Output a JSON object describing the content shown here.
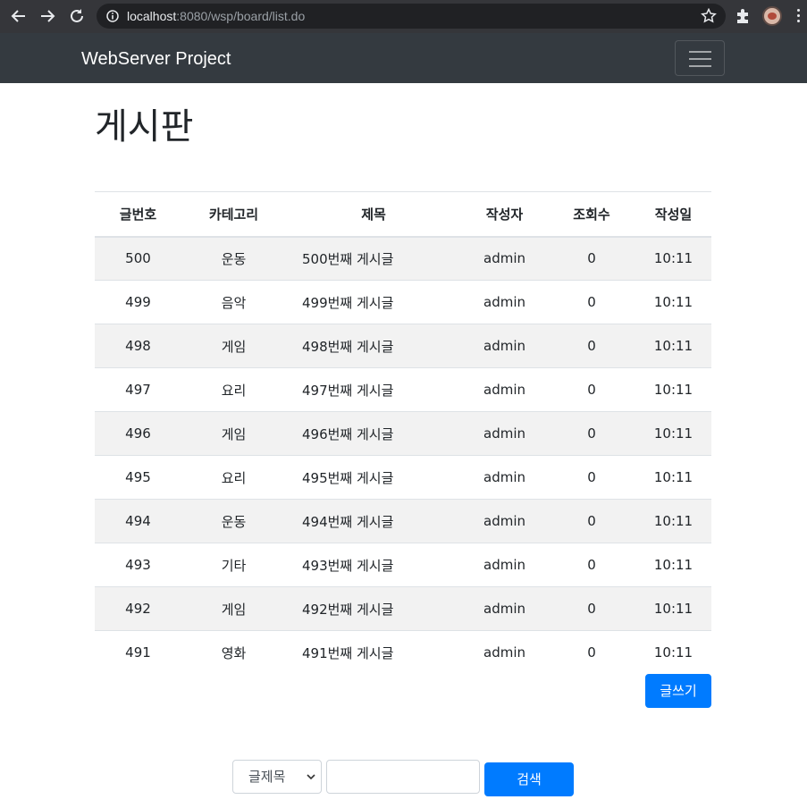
{
  "browser": {
    "url_host": "localhost",
    "url_path": ":8080/wsp/board/list.do"
  },
  "navbar": {
    "brand": "WebServer Project"
  },
  "page": {
    "title": "게시판"
  },
  "table": {
    "headers": [
      "글번호",
      "카테고리",
      "제목",
      "작성자",
      "조회수",
      "작성일"
    ],
    "rows": [
      {
        "no": "500",
        "category": "운동",
        "title": "500번째 게시글",
        "writer": "admin",
        "views": "0",
        "date": "10:11"
      },
      {
        "no": "499",
        "category": "음악",
        "title": "499번째 게시글",
        "writer": "admin",
        "views": "0",
        "date": "10:11"
      },
      {
        "no": "498",
        "category": "게임",
        "title": "498번째 게시글",
        "writer": "admin",
        "views": "0",
        "date": "10:11"
      },
      {
        "no": "497",
        "category": "요리",
        "title": "497번째 게시글",
        "writer": "admin",
        "views": "0",
        "date": "10:11"
      },
      {
        "no": "496",
        "category": "게임",
        "title": "496번째 게시글",
        "writer": "admin",
        "views": "0",
        "date": "10:11"
      },
      {
        "no": "495",
        "category": "요리",
        "title": "495번째 게시글",
        "writer": "admin",
        "views": "0",
        "date": "10:11"
      },
      {
        "no": "494",
        "category": "운동",
        "title": "494번째 게시글",
        "writer": "admin",
        "views": "0",
        "date": "10:11"
      },
      {
        "no": "493",
        "category": "기타",
        "title": "493번째 게시글",
        "writer": "admin",
        "views": "0",
        "date": "10:11"
      },
      {
        "no": "492",
        "category": "게임",
        "title": "492번째 게시글",
        "writer": "admin",
        "views": "0",
        "date": "10:11"
      },
      {
        "no": "491",
        "category": "영화",
        "title": "491번째 게시글",
        "writer": "admin",
        "views": "0",
        "date": "10:11"
      }
    ]
  },
  "actions": {
    "write_label": "글쓰기"
  },
  "search": {
    "select_value": "글제목",
    "input_value": "",
    "button_label": "검색"
  }
}
